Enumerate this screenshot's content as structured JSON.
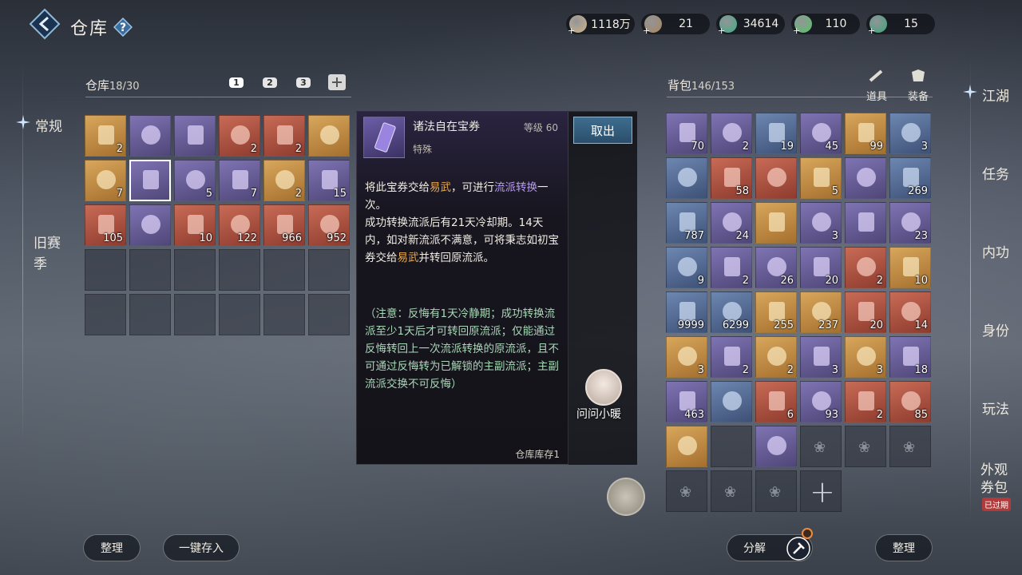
{
  "header": {
    "title": "仓库",
    "help_icon": "question-icon",
    "currencies": [
      {
        "icon": "scroll-icon",
        "value": "1118万",
        "color": "#cdb48a"
      },
      {
        "icon": "copper-coin-icon",
        "value": "21",
        "color": "#a88660"
      },
      {
        "icon": "jade-coin-icon",
        "value": "34614",
        "color": "#3fae84"
      },
      {
        "icon": "green-coin-icon",
        "value": "110",
        "color": "#58c26a"
      },
      {
        "icon": "teal-coin-icon",
        "value": "15",
        "color": "#3ba57a"
      }
    ]
  },
  "left_nav": {
    "items": [
      "常规",
      "旧赛季"
    ],
    "active": "常规"
  },
  "warehouse": {
    "label": "仓库",
    "count": "18/30",
    "tabs": [
      "1",
      "2",
      "3"
    ],
    "rows": [
      [
        {
          "c": "orange",
          "q": "2"
        },
        {
          "c": "purple",
          "q": ""
        },
        {
          "c": "purple",
          "q": ""
        },
        {
          "c": "red",
          "q": "2"
        },
        {
          "c": "red",
          "q": "2"
        },
        {
          "c": "orange",
          "q": ""
        }
      ],
      [
        {
          "c": "orange",
          "q": "7"
        },
        {
          "c": "purple",
          "q": "",
          "sel": true
        },
        {
          "c": "purple",
          "q": "5"
        },
        {
          "c": "purple",
          "q": "7"
        },
        {
          "c": "orange",
          "q": "2"
        },
        {
          "c": "purple",
          "q": "15"
        }
      ],
      [
        {
          "c": "red",
          "q": "105"
        },
        {
          "c": "purple",
          "q": ""
        },
        {
          "c": "red",
          "q": "10"
        },
        {
          "c": "red",
          "q": "122"
        },
        {
          "c": "red",
          "q": "966"
        },
        {
          "c": "red",
          "q": "952"
        }
      ],
      [
        {
          "c": "empty"
        },
        {
          "c": "empty"
        },
        {
          "c": "empty"
        },
        {
          "c": "empty"
        },
        {
          "c": "empty"
        },
        {
          "c": "empty"
        }
      ],
      [
        {
          "c": "empty"
        },
        {
          "c": "empty"
        },
        {
          "c": "empty"
        },
        {
          "c": "empty"
        },
        {
          "c": "empty"
        },
        {
          "c": "empty"
        }
      ]
    ]
  },
  "tooltip": {
    "name": "诸法自在宝券",
    "level": "等级 60",
    "kind": "特殊",
    "desc_p1_a": "将此宝券交给",
    "desc_p1_b": "易武",
    "desc_p1_c": "，可进行",
    "desc_p1_d": "流派转换",
    "desc_p1_e": "一次。",
    "desc_p2_a": "成功转换流派后有21天冷却期。14天内，如对新流派不满意，可将秉志如初宝券交给",
    "desc_p2_b": "易武",
    "desc_p2_c": "并转回原流派。",
    "note": "（注意：反悔有1天冷静期；成功转换流派至少1天后才可转回原流派；仅能通过反悔转回上一次流派转换的原流派，且不可通过反悔转为已解锁的主副流派；主副流派交换不可反悔）",
    "stock": "仓库库存1",
    "take_button": "取出",
    "ask_label": "问问小暖"
  },
  "bag": {
    "label": "背包",
    "count": "146/153",
    "tabs": [
      "道具",
      "装备"
    ],
    "rows": [
      [
        {
          "c": "purple",
          "q": "70"
        },
        {
          "c": "purple",
          "q": "2"
        },
        {
          "c": "blue",
          "q": "19"
        },
        {
          "c": "purple",
          "q": "45"
        },
        {
          "c": "orange",
          "q": "99"
        },
        {
          "c": "blue",
          "q": "3"
        }
      ],
      [
        {
          "c": "blue",
          "q": ""
        },
        {
          "c": "red",
          "q": "58"
        },
        {
          "c": "red",
          "q": ""
        },
        {
          "c": "orange",
          "q": "5"
        },
        {
          "c": "purple",
          "q": ""
        },
        {
          "c": "blue",
          "q": "269"
        }
      ],
      [
        {
          "c": "blue",
          "q": "787"
        },
        {
          "c": "purple",
          "q": "24"
        },
        {
          "c": "orange",
          "q": ""
        },
        {
          "c": "purple",
          "q": "3"
        },
        {
          "c": "purple",
          "q": ""
        },
        {
          "c": "purple",
          "q": "23"
        }
      ],
      [
        {
          "c": "blue",
          "q": "9"
        },
        {
          "c": "purple",
          "q": "2"
        },
        {
          "c": "purple",
          "q": "26"
        },
        {
          "c": "purple",
          "q": "20"
        },
        {
          "c": "red",
          "q": "2"
        },
        {
          "c": "orange",
          "q": "10"
        }
      ],
      [
        {
          "c": "blue",
          "q": "9999"
        },
        {
          "c": "blue",
          "q": "6299"
        },
        {
          "c": "orange",
          "q": "255"
        },
        {
          "c": "orange",
          "q": "237"
        },
        {
          "c": "red",
          "q": "20"
        },
        {
          "c": "red",
          "q": "14"
        }
      ],
      [
        {
          "c": "orange",
          "q": "3"
        },
        {
          "c": "purple",
          "q": "2"
        },
        {
          "c": "orange",
          "q": "2"
        },
        {
          "c": "purple",
          "q": "3"
        },
        {
          "c": "orange",
          "q": "3"
        },
        {
          "c": "purple",
          "q": "18"
        }
      ],
      [
        {
          "c": "purple",
          "q": "463"
        },
        {
          "c": "blue",
          "q": ""
        },
        {
          "c": "red",
          "q": "6"
        },
        {
          "c": "purple",
          "q": "93"
        },
        {
          "c": "red",
          "q": "2"
        },
        {
          "c": "red",
          "q": "85"
        }
      ],
      [
        {
          "c": "orange",
          "q": ""
        },
        {
          "c": "empty"
        },
        {
          "c": "purple",
          "q": ""
        },
        {
          "c": "paw"
        },
        {
          "c": "paw"
        },
        {
          "c": "paw"
        }
      ],
      [
        {
          "c": "paw"
        },
        {
          "c": "paw"
        },
        {
          "c": "paw"
        },
        {
          "c": "plus"
        }
      ]
    ]
  },
  "right_nav": {
    "items": [
      "江湖",
      "任务",
      "内功",
      "身份",
      "玩法",
      "外观券包"
    ],
    "active": "江湖",
    "expired_badge": "已过期"
  },
  "bottom": {
    "sort_left": "整理",
    "deposit_all": "一键存入",
    "decompose": "分解",
    "sort_right": "整理"
  }
}
